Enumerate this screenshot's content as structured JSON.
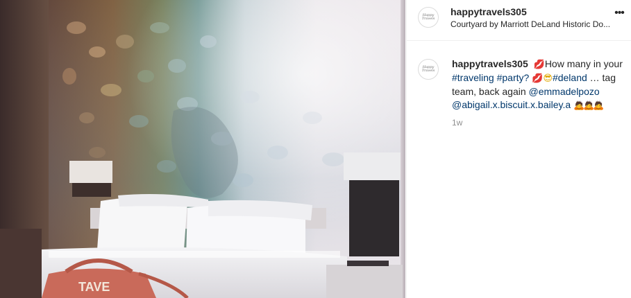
{
  "post": {
    "username": "happytravels305",
    "location": "Courtyard by Marriott DeLand Historic Do...",
    "avatar_text": "Happy Travels",
    "more_icon": "•••"
  },
  "caption": {
    "username": "happytravels305",
    "emoji_kiss": "💋",
    "text1": "How many in your",
    "hashtag_traveling": "#traveling",
    "hashtag_party": "#party?",
    "emoji_kiss2": "💋",
    "emoji_cool": "😎",
    "hashtag_deland": "#deland",
    "text2": " … tag team, back again ",
    "mention1": "@emmadelpozo",
    "mention2": "@abigail.x.biscuit.x.bailey.a",
    "emoji_bow": "🙇🙇🙇",
    "time": "1w"
  },
  "photo": {
    "bag_text": "TAVE",
    "description_icon": "hotel-room-photo"
  },
  "colors": {
    "link": "#00376b",
    "muted": "#8e8e8e",
    "text": "#262626"
  }
}
